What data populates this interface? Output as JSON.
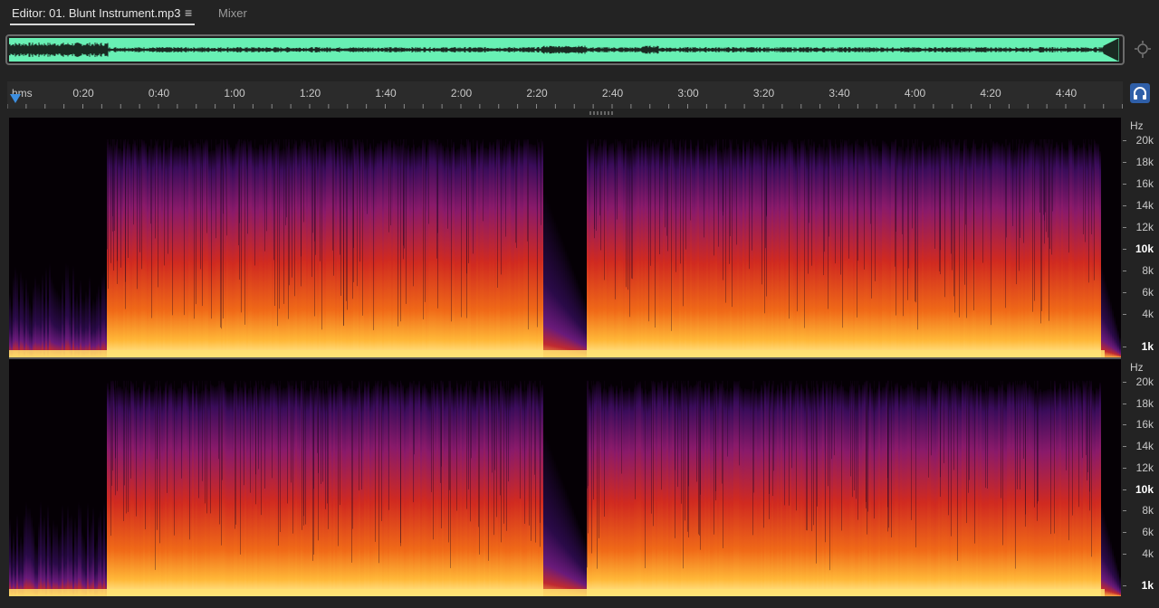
{
  "tabs": {
    "editor_label": "Editor: 01. Blunt Instrument.mp3",
    "menu_icon": "≡",
    "mixer_label": "Mixer"
  },
  "overview": {
    "waveform_color": "#68f0b4",
    "zoom_icon": "zoom-navigator-icon"
  },
  "ruler": {
    "unit": "hms",
    "ticks": [
      "0:20",
      "0:40",
      "1:00",
      "1:20",
      "1:40",
      "2:00",
      "2:20",
      "2:40",
      "3:00",
      "3:20",
      "3:40",
      "4:00",
      "4:20",
      "4:40"
    ],
    "headphone_icon": "headphones-icon"
  },
  "spectral": {
    "hz_label": "Hz",
    "freq_labels": [
      "20k",
      "18k",
      "16k",
      "14k",
      "12k",
      "10k",
      "8k",
      "6k",
      "4k",
      "1k"
    ],
    "bold_labels": [
      "10k",
      "1k"
    ],
    "colors": {
      "low": "#050005",
      "mid": "#7a1a8a",
      "hot": "#e8401a",
      "peak": "#ffe070"
    }
  }
}
